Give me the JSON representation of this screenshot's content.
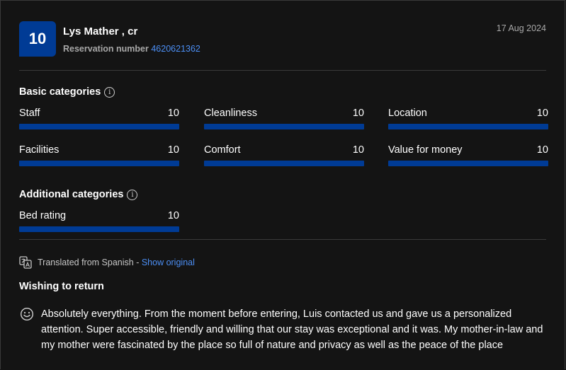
{
  "review": {
    "score": "10",
    "reviewer": "Lys Mather , cr",
    "reservation_label": "Reservation number",
    "reservation_number": "4620621362",
    "date": "17 Aug 2024"
  },
  "basic": {
    "title": "Basic categories",
    "items": [
      {
        "label": "Staff",
        "score": "10",
        "fraction": 1.0
      },
      {
        "label": "Cleanliness",
        "score": "10",
        "fraction": 1.0
      },
      {
        "label": "Location",
        "score": "10",
        "fraction": 1.0
      },
      {
        "label": "Facilities",
        "score": "10",
        "fraction": 1.0
      },
      {
        "label": "Comfort",
        "score": "10",
        "fraction": 1.0
      },
      {
        "label": "Value for money",
        "score": "10",
        "fraction": 1.0
      }
    ]
  },
  "additional": {
    "title": "Additional categories",
    "items": [
      {
        "label": "Bed rating",
        "score": "10",
        "fraction": 1.0
      }
    ]
  },
  "translation": {
    "text": "Translated from Spanish",
    "separator": " - ",
    "link": "Show original"
  },
  "content": {
    "title": "Wishing to return",
    "body": "Absolutely everything. From the moment before entering, Luis contacted us and gave us a personalized attention. Super accessible, friendly and willing that our stay was exceptional and it was. My mother-in-law and my mother were fascinated by the place so full of nature and privacy as well as the peace of the place"
  },
  "icons": {
    "info": "info-icon",
    "translate": "translate-icon",
    "positive": "smiley-face-icon"
  },
  "colors": {
    "accent": "#003b95",
    "link": "#4c8ff5",
    "background": "#141414"
  }
}
